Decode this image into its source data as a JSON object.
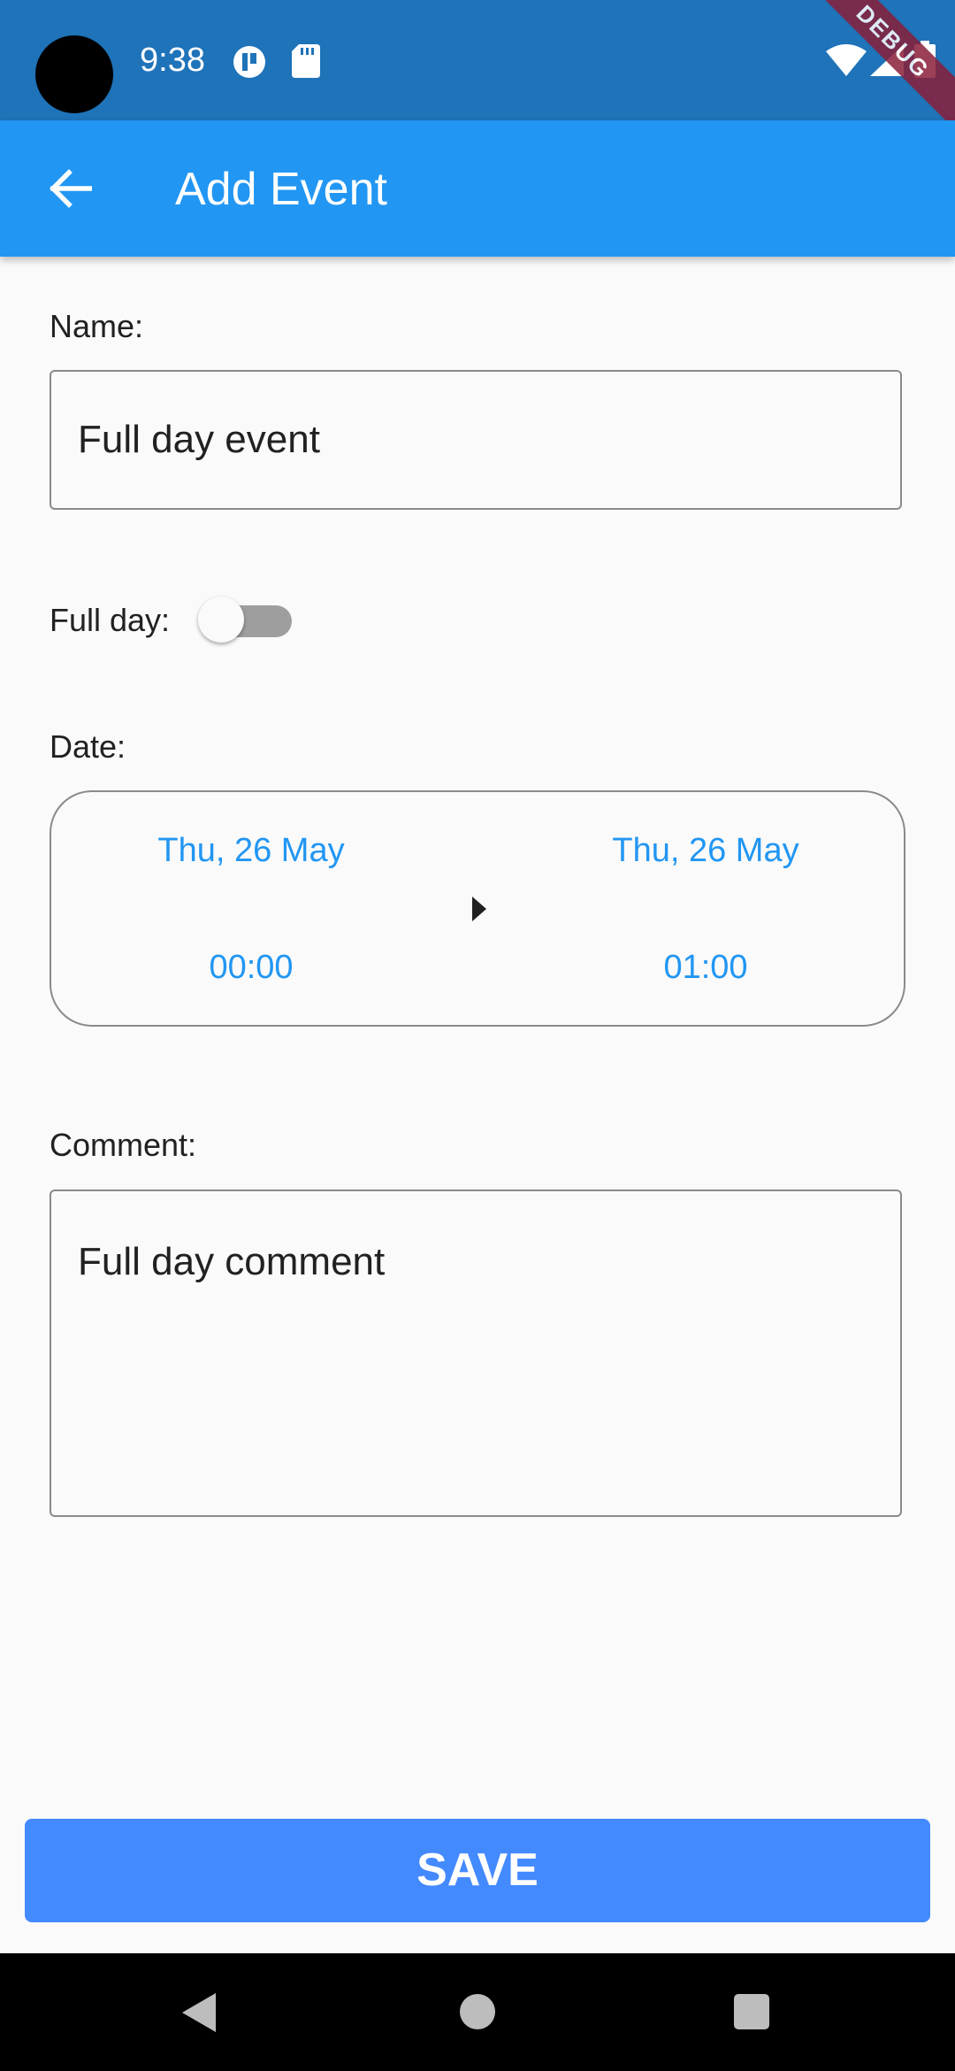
{
  "status_bar": {
    "time": "9:38",
    "debug_label": "DEBUG",
    "icons": [
      "camera-cutout",
      "app-notification-icon",
      "sd-card-icon",
      "wifi-icon",
      "signal-icon",
      "battery-icon"
    ]
  },
  "app_bar": {
    "title": "Add Event",
    "back_icon": "arrow-back-icon",
    "color": "#2196f3"
  },
  "form": {
    "name_label": "Name:",
    "name_value": "Full day event",
    "full_day_label": "Full day:",
    "full_day_enabled": false,
    "date_label": "Date:",
    "start_date": "Thu, 26 May",
    "start_time": "00:00",
    "end_date": "Thu, 26 May",
    "end_time": "01:00",
    "comment_label": "Comment:",
    "comment_value": "Full day comment"
  },
  "save_button": {
    "label": "SAVE",
    "color": "#448aff"
  },
  "nav_bar": {
    "icons": [
      "nav-back-icon",
      "nav-home-icon",
      "nav-recents-icon"
    ]
  }
}
